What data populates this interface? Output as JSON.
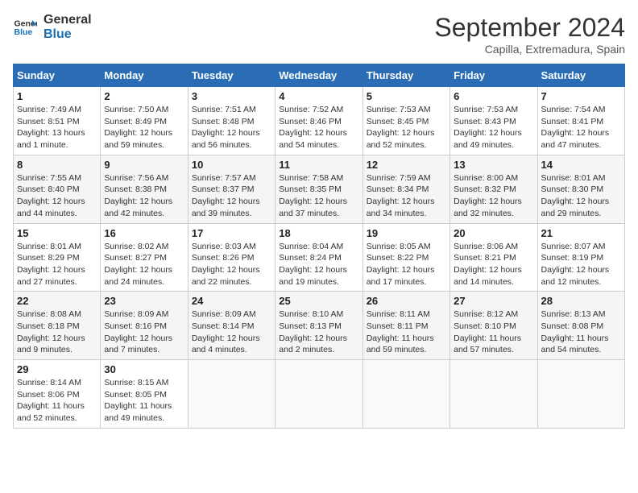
{
  "logo": {
    "line1": "General",
    "line2": "Blue"
  },
  "title": "September 2024",
  "subtitle": "Capilla, Extremadura, Spain",
  "days_of_week": [
    "Sunday",
    "Monday",
    "Tuesday",
    "Wednesday",
    "Thursday",
    "Friday",
    "Saturday"
  ],
  "weeks": [
    [
      {
        "day": "1",
        "info": "Sunrise: 7:49 AM\nSunset: 8:51 PM\nDaylight: 13 hours\nand 1 minute."
      },
      {
        "day": "2",
        "info": "Sunrise: 7:50 AM\nSunset: 8:49 PM\nDaylight: 12 hours\nand 59 minutes."
      },
      {
        "day": "3",
        "info": "Sunrise: 7:51 AM\nSunset: 8:48 PM\nDaylight: 12 hours\nand 56 minutes."
      },
      {
        "day": "4",
        "info": "Sunrise: 7:52 AM\nSunset: 8:46 PM\nDaylight: 12 hours\nand 54 minutes."
      },
      {
        "day": "5",
        "info": "Sunrise: 7:53 AM\nSunset: 8:45 PM\nDaylight: 12 hours\nand 52 minutes."
      },
      {
        "day": "6",
        "info": "Sunrise: 7:53 AM\nSunset: 8:43 PM\nDaylight: 12 hours\nand 49 minutes."
      },
      {
        "day": "7",
        "info": "Sunrise: 7:54 AM\nSunset: 8:41 PM\nDaylight: 12 hours\nand 47 minutes."
      }
    ],
    [
      {
        "day": "8",
        "info": "Sunrise: 7:55 AM\nSunset: 8:40 PM\nDaylight: 12 hours\nand 44 minutes."
      },
      {
        "day": "9",
        "info": "Sunrise: 7:56 AM\nSunset: 8:38 PM\nDaylight: 12 hours\nand 42 minutes."
      },
      {
        "day": "10",
        "info": "Sunrise: 7:57 AM\nSunset: 8:37 PM\nDaylight: 12 hours\nand 39 minutes."
      },
      {
        "day": "11",
        "info": "Sunrise: 7:58 AM\nSunset: 8:35 PM\nDaylight: 12 hours\nand 37 minutes."
      },
      {
        "day": "12",
        "info": "Sunrise: 7:59 AM\nSunset: 8:34 PM\nDaylight: 12 hours\nand 34 minutes."
      },
      {
        "day": "13",
        "info": "Sunrise: 8:00 AM\nSunset: 8:32 PM\nDaylight: 12 hours\nand 32 minutes."
      },
      {
        "day": "14",
        "info": "Sunrise: 8:01 AM\nSunset: 8:30 PM\nDaylight: 12 hours\nand 29 minutes."
      }
    ],
    [
      {
        "day": "15",
        "info": "Sunrise: 8:01 AM\nSunset: 8:29 PM\nDaylight: 12 hours\nand 27 minutes."
      },
      {
        "day": "16",
        "info": "Sunrise: 8:02 AM\nSunset: 8:27 PM\nDaylight: 12 hours\nand 24 minutes."
      },
      {
        "day": "17",
        "info": "Sunrise: 8:03 AM\nSunset: 8:26 PM\nDaylight: 12 hours\nand 22 minutes."
      },
      {
        "day": "18",
        "info": "Sunrise: 8:04 AM\nSunset: 8:24 PM\nDaylight: 12 hours\nand 19 minutes."
      },
      {
        "day": "19",
        "info": "Sunrise: 8:05 AM\nSunset: 8:22 PM\nDaylight: 12 hours\nand 17 minutes."
      },
      {
        "day": "20",
        "info": "Sunrise: 8:06 AM\nSunset: 8:21 PM\nDaylight: 12 hours\nand 14 minutes."
      },
      {
        "day": "21",
        "info": "Sunrise: 8:07 AM\nSunset: 8:19 PM\nDaylight: 12 hours\nand 12 minutes."
      }
    ],
    [
      {
        "day": "22",
        "info": "Sunrise: 8:08 AM\nSunset: 8:18 PM\nDaylight: 12 hours\nand 9 minutes."
      },
      {
        "day": "23",
        "info": "Sunrise: 8:09 AM\nSunset: 8:16 PM\nDaylight: 12 hours\nand 7 minutes."
      },
      {
        "day": "24",
        "info": "Sunrise: 8:09 AM\nSunset: 8:14 PM\nDaylight: 12 hours\nand 4 minutes."
      },
      {
        "day": "25",
        "info": "Sunrise: 8:10 AM\nSunset: 8:13 PM\nDaylight: 12 hours\nand 2 minutes."
      },
      {
        "day": "26",
        "info": "Sunrise: 8:11 AM\nSunset: 8:11 PM\nDaylight: 11 hours\nand 59 minutes."
      },
      {
        "day": "27",
        "info": "Sunrise: 8:12 AM\nSunset: 8:10 PM\nDaylight: 11 hours\nand 57 minutes."
      },
      {
        "day": "28",
        "info": "Sunrise: 8:13 AM\nSunset: 8:08 PM\nDaylight: 11 hours\nand 54 minutes."
      }
    ],
    [
      {
        "day": "29",
        "info": "Sunrise: 8:14 AM\nSunset: 8:06 PM\nDaylight: 11 hours\nand 52 minutes."
      },
      {
        "day": "30",
        "info": "Sunrise: 8:15 AM\nSunset: 8:05 PM\nDaylight: 11 hours\nand 49 minutes."
      },
      {
        "day": "",
        "info": ""
      },
      {
        "day": "",
        "info": ""
      },
      {
        "day": "",
        "info": ""
      },
      {
        "day": "",
        "info": ""
      },
      {
        "day": "",
        "info": ""
      }
    ]
  ]
}
